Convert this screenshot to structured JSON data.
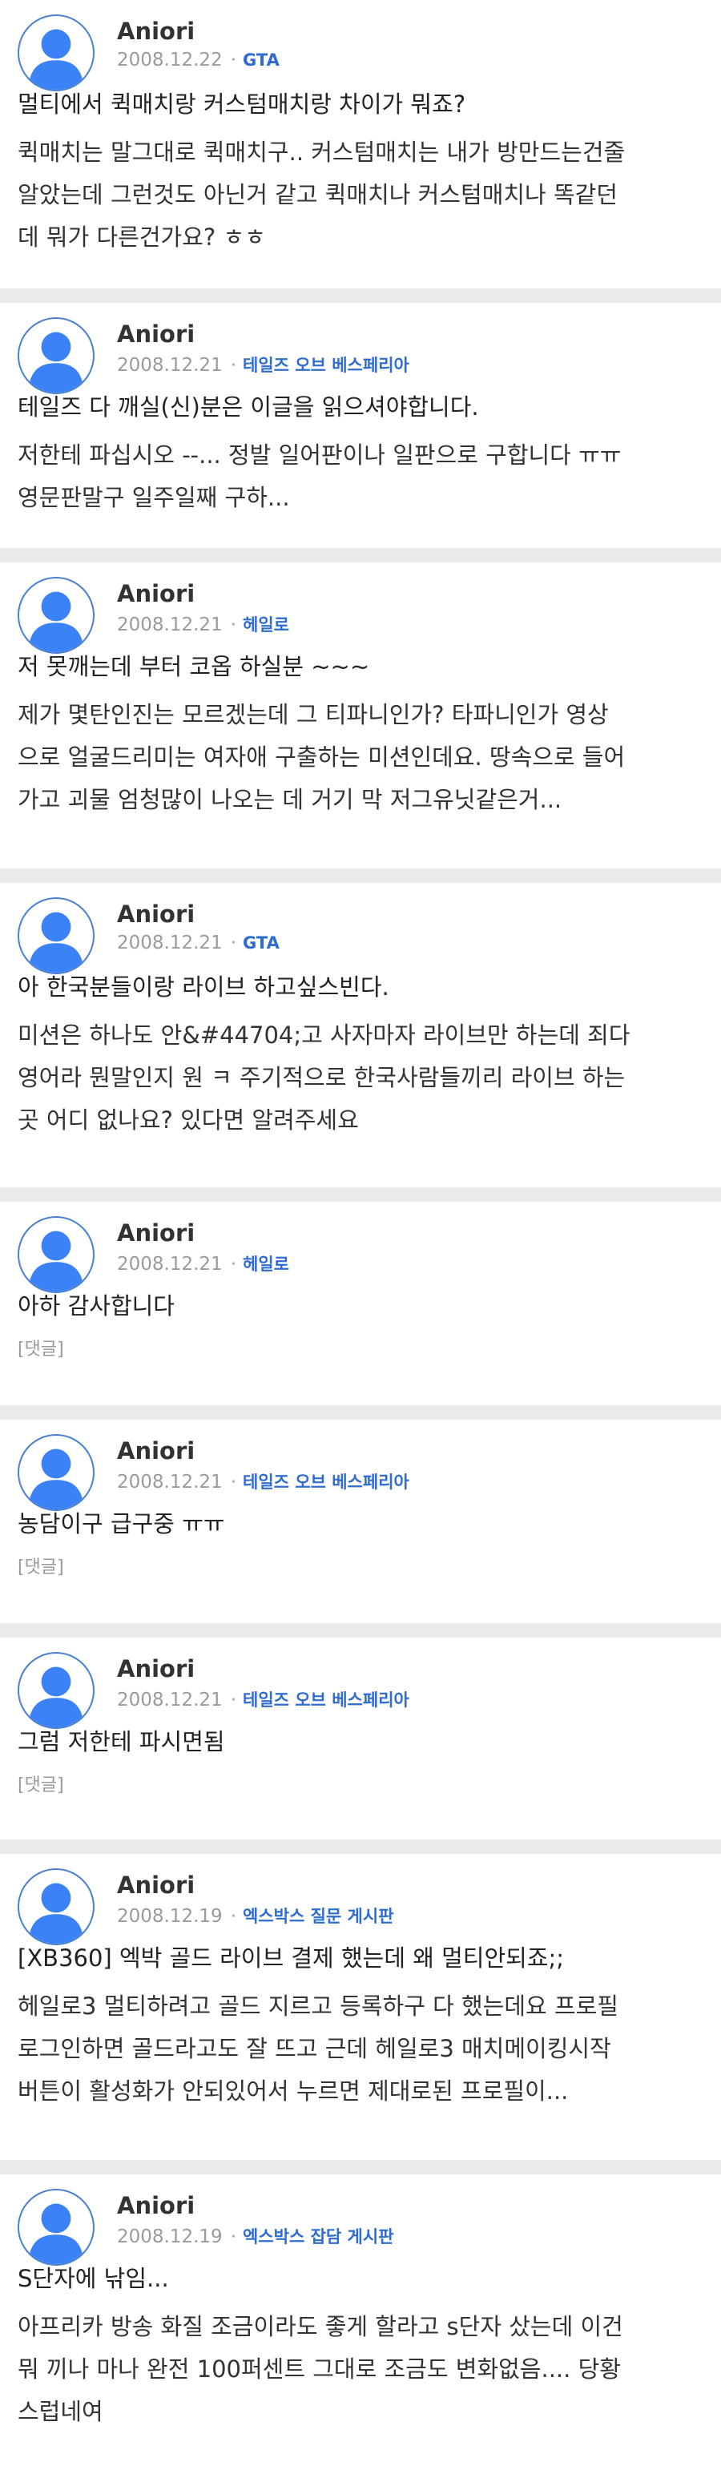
{
  "avatar_color": "#3b82f6",
  "posts": [
    {
      "author": "Aniori",
      "date": "2008.12.22",
      "board": "GTA",
      "title": "멀티에서 퀵매치랑 커스텀매치랑 차이가 뭐죠?",
      "body": [
        "퀵매치는 말그대로 퀵매치구.. 커스텀매치는 내가 방만드는건줄",
        "알았는데 그런것도 아닌거 같고 퀵매치나 커스텀매치나 똑같던",
        "데 뭐가 다른건가요? ㅎㅎ"
      ]
    },
    {
      "author": "Aniori",
      "date": "2008.12.21",
      "board": "테일즈 오브 베스페리아",
      "title": "테일즈 다 깨실(신)분은 이글을 읽으셔야합니다.",
      "body": [
        "저한테 파십시오 --... 정발 일어판이나 일판으로 구합니다 ㅠㅠ",
        "영문판말구 일주일째 구하..."
      ]
    },
    {
      "author": "Aniori",
      "date": "2008.12.21",
      "board": "헤일로",
      "title": "저 못깨는데 부터 코옵 하실분 ~~~",
      "body": [
        "제가 몇탄인진는 모르겠는데 그 티파니인가? 타파니인가 영상",
        "으로 얼굴드리미는 여자애 구출하는 미션인데요. 땅속으로 들어",
        "가고 괴물 엄청많이 나오는 데 거기 막 저그유닛같은거..."
      ]
    },
    {
      "author": "Aniori",
      "date": "2008.12.21",
      "board": "GTA",
      "title": "아 한국분들이랑 라이브 하고싶스빈다.",
      "body": [
        "미션은 하나도 안&#44704;고 사자마자 라이브만 하는데 죄다",
        "영어라 뭔말인지 원 ㅋ 주기적으로 한국사람들끼리 라이브 하는",
        "곳 어디 없나요? 있다면 알려주세요"
      ]
    },
    {
      "author": "Aniori",
      "date": "2008.12.21",
      "board": "헤일로",
      "title": "아하 감사합니다",
      "reply": "[댓글]"
    },
    {
      "author": "Aniori",
      "date": "2008.12.21",
      "board": "테일즈 오브 베스페리아",
      "title": "농담이구 급구중 ㅠㅠ",
      "reply": "[댓글]"
    },
    {
      "author": "Aniori",
      "date": "2008.12.21",
      "board": "테일즈 오브 베스페리아",
      "title": "그럼 저한테 파시면됨",
      "reply": "[댓글]"
    },
    {
      "author": "Aniori",
      "date": "2008.12.19",
      "board": "엑스박스 질문 게시판",
      "title": "[XB360] 엑박 골드 라이브 결제 했는데 왜 멀티안되죠;;",
      "body": [
        "헤일로3 멀티하려고 골드 지르고 등록하구 다 했는데요 프로필",
        "로그인하면 골드라고도 잘 뜨고 근데 헤일로3 매치메이킹시작",
        "버튼이 활성화가 안되있어서 누르면 제대로된 프로필이..."
      ]
    },
    {
      "author": "Aniori",
      "date": "2008.12.19",
      "board": "엑스박스 잡담 게시판",
      "title": "S단자에 낚임...",
      "body": [
        "아프리카 방송 화질 조금이라도 좋게 할라고 s단자 샀는데 이건",
        "뭐 끼나 마나 완전 100퍼센트 그대로 조금도 변화없음.... 당황",
        "스럽네여"
      ]
    }
  ]
}
